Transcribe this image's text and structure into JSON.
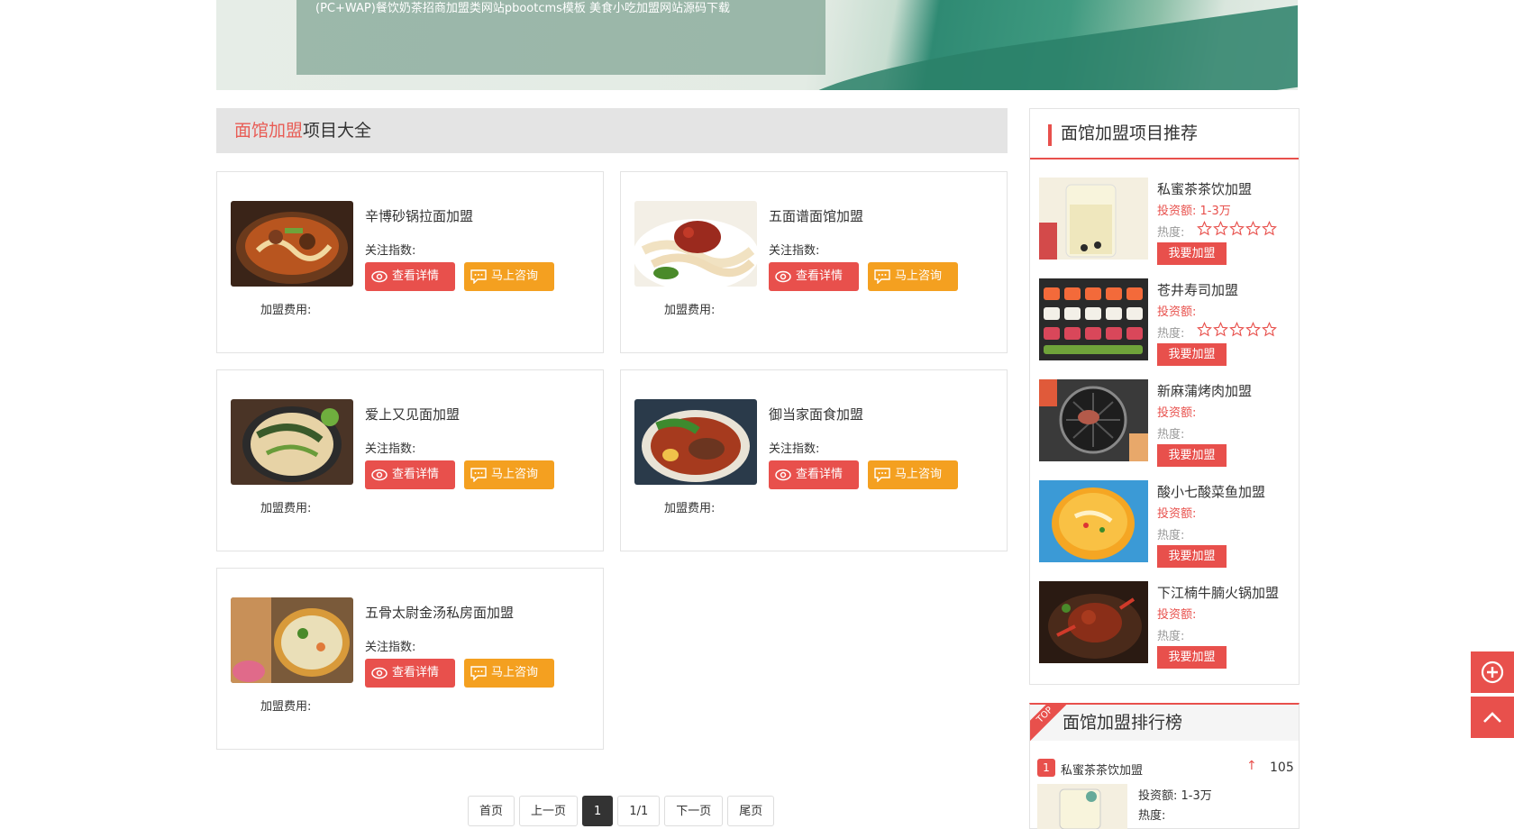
{
  "banner": {
    "caption": "(PC+WAP)餐饮奶茶招商加盟类网站pbootcms模板 美食小吃加盟网站源码下载"
  },
  "section": {
    "title_highlight": "面馆加盟",
    "title_rest": "项目大全"
  },
  "labels": {
    "attention": "关注指数:",
    "detail_button": "查看详情",
    "consult_button": "马上咨询",
    "fee": "加盟费用:",
    "join_button": "我要加盟",
    "heat": "热度:"
  },
  "listings": [
    {
      "name": "辛博砂锅拉面加盟"
    },
    {
      "name": "五面谱面馆加盟"
    },
    {
      "name": "爱上又见面加盟"
    },
    {
      "name": "御当家面食加盟"
    },
    {
      "name": "五骨太尉金汤私房面加盟"
    }
  ],
  "pagination": [
    "首页",
    "上一页",
    "1",
    "1/1",
    "下一页",
    "尾页"
  ],
  "sidebar": {
    "title": "面馆加盟项目推荐",
    "items": [
      {
        "name": "私蜜茶茶饮加盟",
        "invest": "投资额: 1-3万",
        "heat": "热度:"
      },
      {
        "name": "苍井寿司加盟",
        "invest": "投资额:",
        "heat": "热度:"
      },
      {
        "name": "新麻蒲烤肉加盟",
        "invest": "投资额:",
        "heat": "热度:"
      },
      {
        "name": "酸小七酸菜鱼加盟",
        "invest": "投资额:",
        "heat": "热度:"
      },
      {
        "name": "下江楠牛腩火锅加盟",
        "invest": "投资额:",
        "heat": "热度:"
      }
    ]
  },
  "ranking": {
    "tag": "TOP",
    "title": "面馆加盟排行榜",
    "items": [
      {
        "rank": "1",
        "name": "私蜜茶茶饮加盟",
        "score": "105",
        "invest": "投资额: 1-3万",
        "heat": "热度:"
      }
    ]
  },
  "colors": {
    "accent": "#e8504c",
    "orange": "#f4a020"
  }
}
